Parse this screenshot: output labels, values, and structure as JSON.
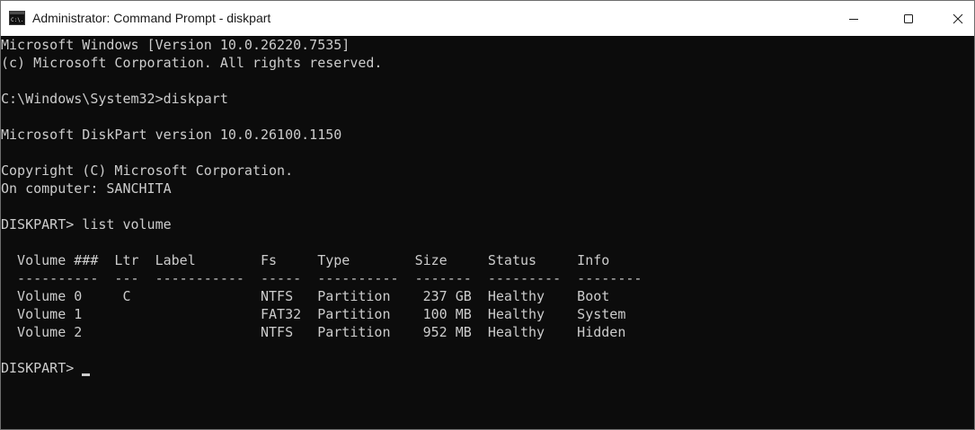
{
  "window": {
    "title": "Administrator: Command Prompt - diskpart",
    "icon": "cmd-app-icon",
    "icon_text": "C:\\.",
    "controls": [
      "minimize-icon",
      "maximize-icon",
      "close-icon"
    ]
  },
  "console": {
    "lines": [
      "Microsoft Windows [Version 10.0.26220.7535]",
      "(c) Microsoft Corporation. All rights reserved.",
      "",
      "C:\\Windows\\System32>diskpart",
      "",
      "Microsoft DiskPart version 10.0.26100.1150",
      "",
      "Copyright (C) Microsoft Corporation.",
      "On computer: SANCHITA",
      "",
      "DISKPART> list volume",
      "",
      "  Volume ###  Ltr  Label        Fs     Type        Size     Status     Info",
      "  ----------  ---  -----------  -----  ----------  -------  ---------  --------",
      "  Volume 0     C                NTFS   Partition    237 GB  Healthy    Boot",
      "  Volume 1                      FAT32  Partition    100 MB  Healthy    System",
      "  Volume 2                      NTFS   Partition    952 MB  Healthy    Hidden",
      ""
    ],
    "prompt": "DISKPART> ",
    "input_value": ""
  },
  "colors": {
    "console_bg": "#0c0c0c",
    "console_text": "#cccccc",
    "titlebar_bg": "#ffffff",
    "title_text": "#1a1a1a"
  }
}
